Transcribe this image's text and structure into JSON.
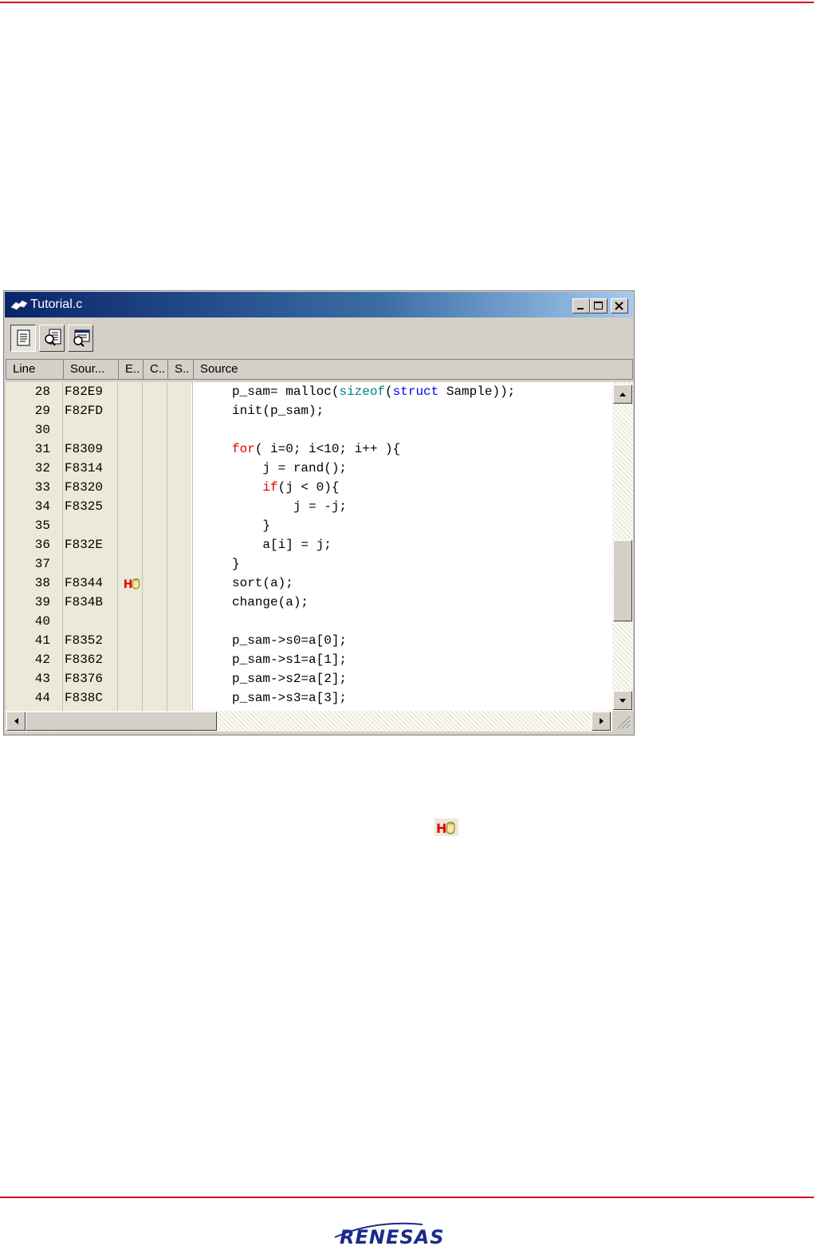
{
  "window": {
    "title": "Tutorial.c",
    "toolbar_icons": [
      "source-view-icon",
      "mixed-view-icon",
      "disassembly-view-icon"
    ]
  },
  "columns": {
    "line": "Line",
    "source_address": "Sour...",
    "event": "E..",
    "coverage": "C..",
    "s": "S..",
    "source": "Source"
  },
  "rows": [
    {
      "line": "28",
      "addr": "F82E9",
      "code": [
        {
          "t": "p_sam= malloc("
        },
        {
          "t": "sizeof",
          "c": "kf"
        },
        {
          "t": "("
        },
        {
          "t": "struct",
          "c": "kt"
        },
        {
          "t": " Sample));"
        }
      ]
    },
    {
      "line": "29",
      "addr": "F82FD",
      "code": [
        {
          "t": "init(p_sam);"
        }
      ]
    },
    {
      "line": "30",
      "addr": "",
      "code": []
    },
    {
      "line": "31",
      "addr": "F8309",
      "code": [
        {
          "t": "for",
          "c": "kw"
        },
        {
          "t": "( i=0; i<10; i++ ){"
        }
      ]
    },
    {
      "line": "32",
      "addr": "F8314",
      "code": [
        {
          "t": "    j = rand();"
        }
      ]
    },
    {
      "line": "33",
      "addr": "F8320",
      "code": [
        {
          "t": "    "
        },
        {
          "t": "if",
          "c": "kw"
        },
        {
          "t": "(j < 0){"
        }
      ]
    },
    {
      "line": "34",
      "addr": "F8325",
      "code": [
        {
          "t": "        j = -j;"
        }
      ]
    },
    {
      "line": "35",
      "addr": "",
      "code": [
        {
          "t": "    }"
        }
      ]
    },
    {
      "line": "36",
      "addr": "F832E",
      "code": [
        {
          "t": "    a[i] = j;"
        }
      ]
    },
    {
      "line": "37",
      "addr": "",
      "code": [
        {
          "t": "}"
        }
      ]
    },
    {
      "line": "38",
      "addr": "F8344",
      "event": "hardware-break-icon",
      "code": [
        {
          "t": "sort(a);"
        }
      ]
    },
    {
      "line": "39",
      "addr": "F834B",
      "code": [
        {
          "t": "change(a);"
        }
      ]
    },
    {
      "line": "40",
      "addr": "",
      "code": []
    },
    {
      "line": "41",
      "addr": "F8352",
      "code": [
        {
          "t": "p_sam->s0=a[0];"
        }
      ]
    },
    {
      "line": "42",
      "addr": "F8362",
      "code": [
        {
          "t": "p_sam->s1=a[1];"
        }
      ]
    },
    {
      "line": "43",
      "addr": "F8376",
      "code": [
        {
          "t": "p_sam->s2=a[2];"
        }
      ]
    },
    {
      "line": "44",
      "addr": "F838C",
      "code": [
        {
          "t": "p_sam->s3=a[3];"
        }
      ]
    }
  ],
  "colors": {
    "keyword": "#e00000",
    "type": "#0000ff",
    "builtin": "#008080",
    "accent_rule": "#d0021b"
  },
  "footer": {
    "logo": "RENESAS"
  },
  "inline_icon": "hardware-break-icon"
}
